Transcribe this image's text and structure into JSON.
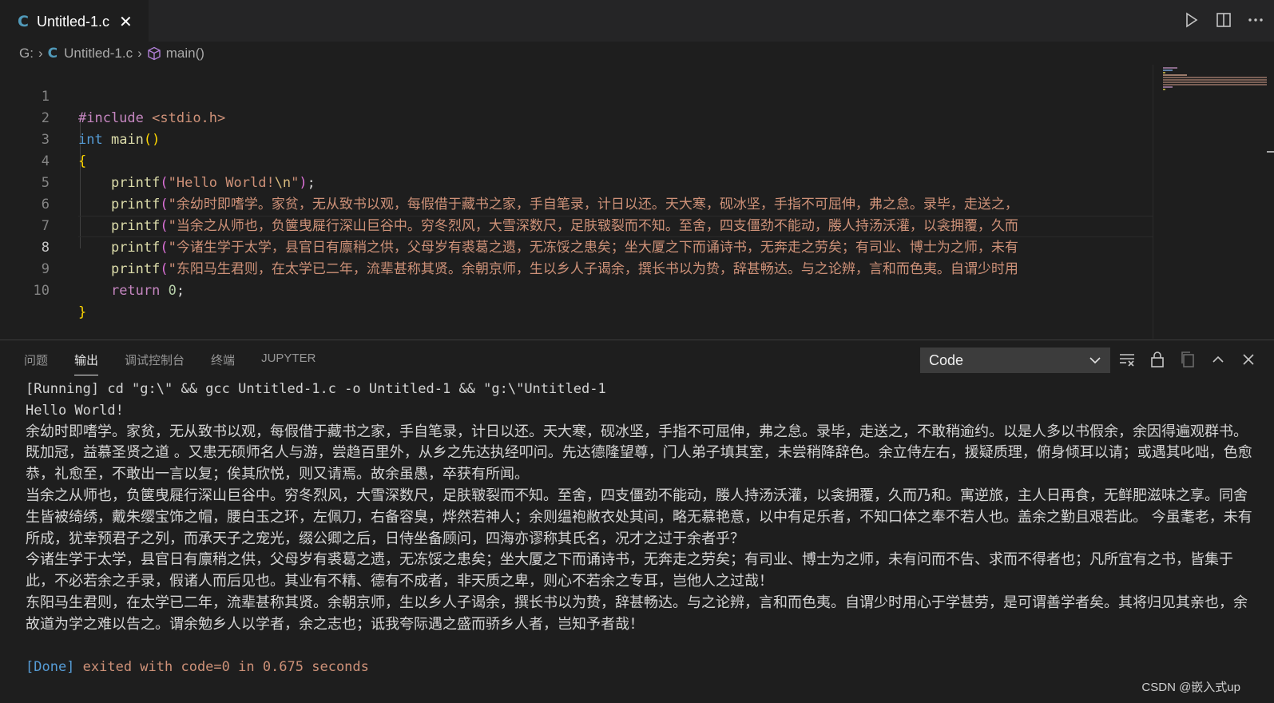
{
  "tab": {
    "icon": "c-language-icon",
    "filename": "Untitled-1.c"
  },
  "breadcrumb": {
    "drive": "G:",
    "file": "Untitled-1.c",
    "symbol": "main()"
  },
  "editor": {
    "lines": [
      {
        "n": "1",
        "text": "#include <stdio.h>"
      },
      {
        "n": "2",
        "text": "int main()"
      },
      {
        "n": "3",
        "text": "{"
      },
      {
        "n": "4",
        "text": "    printf(\"Hello World!\\n\");"
      },
      {
        "n": "5",
        "text": "    printf(\"余幼时即嗜学。家贫，无从致书以观，每假借于藏书之家，手自笔录，计日以还。天大寒，砚冰坚，手指不可屈伸，弗之怠。录毕，走送之，"
      },
      {
        "n": "6",
        "text": "    printf(\"当余之从师也，负箧曳屣行深山巨谷中。穷冬烈风，大雪深数尺，足肤皲裂而不知。至舍，四支僵劲不能动，媵人持汤沃灌，以衾拥覆，久而"
      },
      {
        "n": "7",
        "text": "    printf(\"今诸生学于太学，县官日有廪稍之供，父母岁有裘葛之遗，无冻馁之患矣；坐大厦之下而诵诗书，无奔走之劳矣；有司业、博士为之师，未有"
      },
      {
        "n": "8",
        "text": "    printf(\"东阳马生君则，在太学已二年，流辈甚称其贤。余朝京师，生以乡人子谒余，撰长书以为贽，辞甚畅达。与之论辨，言和而色夷。自谓少时用"
      },
      {
        "n": "9",
        "text": "    return 0;"
      },
      {
        "n": "10",
        "text": "}"
      }
    ],
    "current_line": "8"
  },
  "panel": {
    "tabs": [
      "问题",
      "输出",
      "调试控制台",
      "终端",
      "JUPYTER"
    ],
    "active_tab": "输出",
    "channel": "Code",
    "output": {
      "command": "[Running] cd \"g:\\\" && gcc Untitled-1.c -o Untitled-1 && \"g:\\\"Untitled-1",
      "hello": "Hello World!",
      "para1": "余幼时即嗜学。家贫，无从致书以观，每假借于藏书之家，手自笔录，计日以还。天大寒，砚冰坚，手指不可屈伸，弗之怠。录毕，走送之，不敢稍逾约。以是人多以书假余，余因得遍观群书。既加冠，益慕圣贤之道 。又患无硕师名人与游，尝趋百里外，从乡之先达执经叩问。先达德隆望尊，门人弟子填其室，未尝稍降辞色。余立侍左右，援疑质理，俯身倾耳以请；或遇其叱咄，色愈恭，礼愈至，不敢出一言以复；俟其欣悦，则又请焉。故余虽愚，卒获有所闻。",
      "para2": "当余之从师也，负箧曳屣行深山巨谷中。穷冬烈风，大雪深数尺，足肤皲裂而不知。至舍，四支僵劲不能动，媵人持汤沃灌，以衾拥覆，久而乃和。寓逆旅，主人日再食，无鲜肥滋味之享。同舍生皆被绮绣，戴朱缨宝饰之帽，腰白玉之环，左佩刀，右备容臭，烨然若神人；余则缊袍敝衣处其间，略无慕艳意，以中有足乐者，不知口体之奉不若人也。盖余之勤且艰若此。 今虽耄老，未有所成，犹幸预君子之列，而承天子之宠光，缀公卿之后，日侍坐备顾问，四海亦谬称其氏名，况才之过于余者乎？",
      "para3": "今诸生学于太学，县官日有廪稍之供，父母岁有裘葛之遗，无冻馁之患矣；坐大厦之下而诵诗书，无奔走之劳矣；有司业、博士为之师，未有问而不告、求而不得者也；凡所宜有之书，皆集于此，不必若余之手录，假诸人而后见也。其业有不精、德有不成者，非天质之卑，则心不若余之专耳，岂他人之过哉！",
      "para4": "东阳马生君则，在太学已二年，流辈甚称其贤。余朝京师，生以乡人子谒余，撰长书以为贽，辞甚畅达。与之论辨，言和而色夷。自谓少时用心于学甚劳，是可谓善学者矣。其将归见其亲也，余故道为学之难以告之。谓余勉乡人以学者，余之志也；诋我夸际遇之盛而骄乡人者，岂知予者哉！",
      "done_tag": "[Done]",
      "done_rest": " exited with code=0 in 0.675 seconds"
    }
  },
  "watermark": "CSDN @嵌入式up",
  "colors": {
    "keyword": "#569cd6",
    "string": "#ce9178",
    "function": "#dcdcaa",
    "preprocessor": "#c586c0",
    "number": "#b5cea8",
    "bracket_gold": "#ffd700",
    "bracket_purple": "#da70d6",
    "c_icon": "#519aba"
  }
}
